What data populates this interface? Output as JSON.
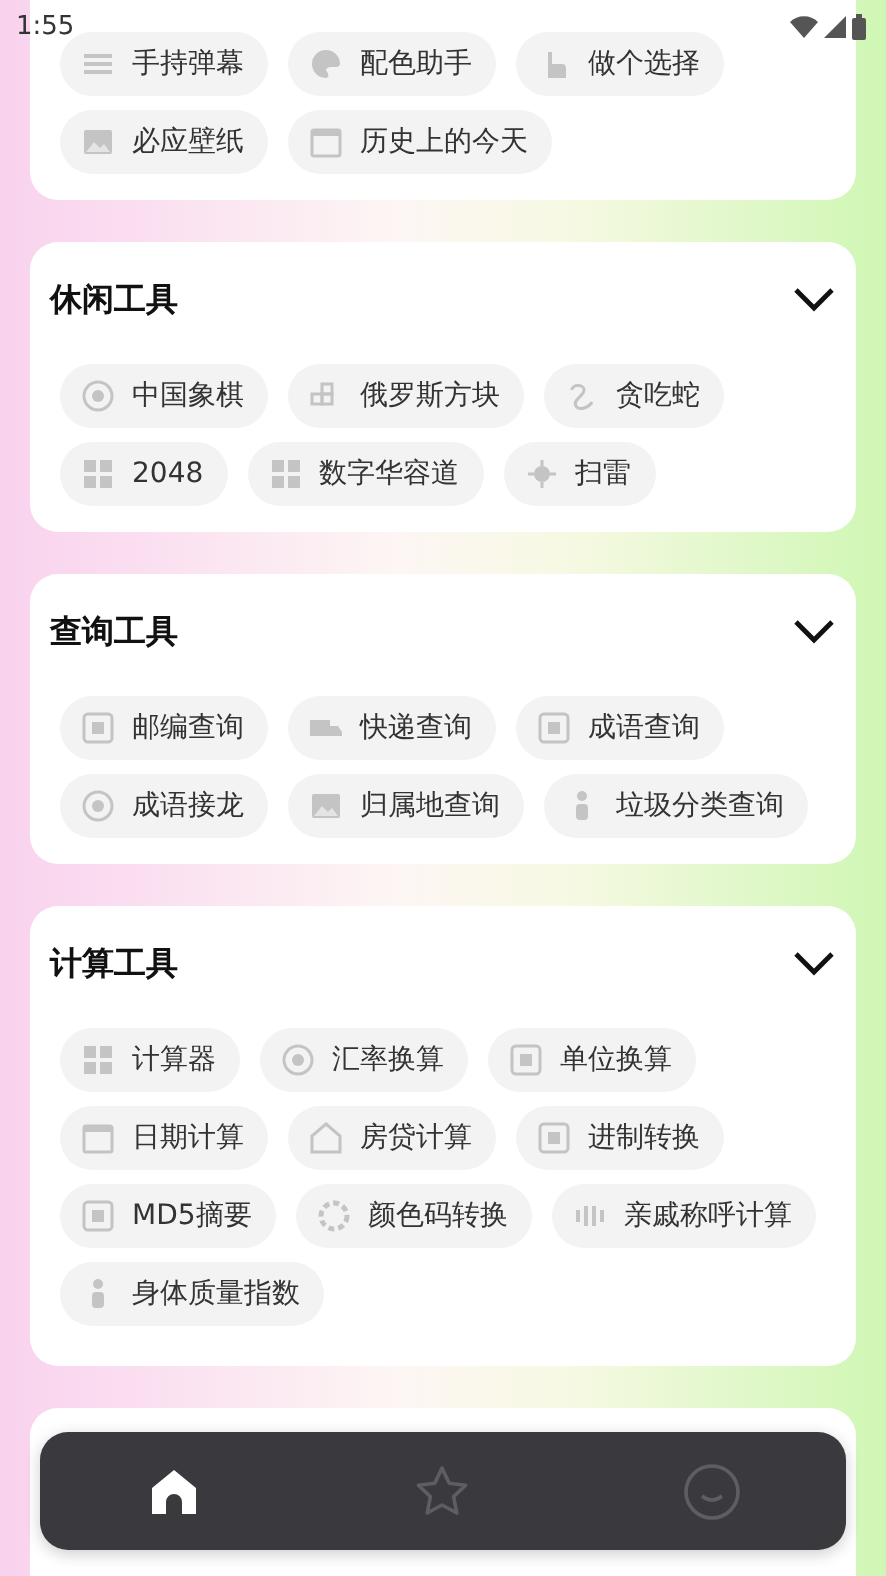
{
  "status_bar": {
    "time": "1:55"
  },
  "sections": [
    {
      "chips": [
        "手持弹幕",
        "配色助手",
        "做个选择",
        "必应壁纸",
        "历史上的今天"
      ]
    },
    {
      "title": "休闲工具",
      "chips": [
        "中国象棋",
        "俄罗斯方块",
        "贪吃蛇",
        "2048",
        "数字华容道",
        "扫雷"
      ]
    },
    {
      "title": "查询工具",
      "chips": [
        "邮编查询",
        "快递查询",
        "成语查询",
        "成语接龙",
        "归属地查询",
        "垃圾分类查询"
      ]
    },
    {
      "title": "计算工具",
      "chips": [
        "计算器",
        "汇率换算",
        "单位换算",
        "日期计算",
        "房贷计算",
        "进制转换",
        "MD5摘要",
        "颜色码转换",
        "亲戚称呼计算",
        "身体质量指数"
      ]
    }
  ],
  "nav_items": [
    {
      "selected": true
    },
    {
      "selected": false
    },
    {
      "selected": false
    }
  ]
}
